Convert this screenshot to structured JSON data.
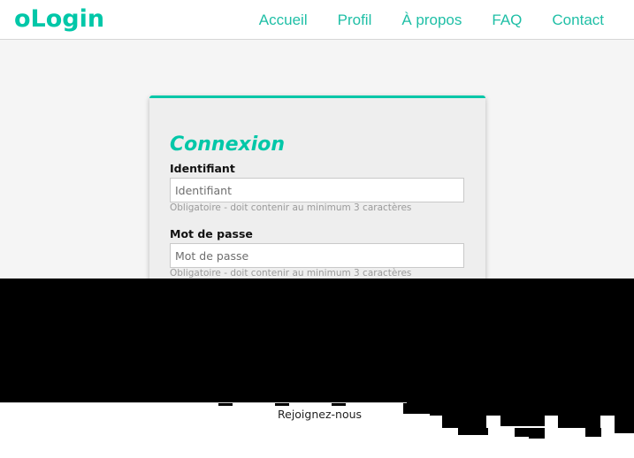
{
  "header": {
    "brand": "oLogin",
    "nav": [
      "Accueil",
      "Profil",
      "À propos",
      "FAQ",
      "Contact"
    ]
  },
  "login": {
    "title": "Connexion",
    "username": {
      "label": "Identifiant",
      "placeholder": "Identifiant",
      "help": "Obligatoire - doit contenir au minimum 3 caractères"
    },
    "password": {
      "label": "Mot de passe",
      "placeholder": "Mot de passe",
      "help": "Obligatoire - doit contenir au minimum 3 caractères"
    }
  },
  "footer": {
    "join_label": "Rejoignez-nous"
  },
  "colors": {
    "accent": "#00c7a8",
    "nav": "#1fbfa6",
    "card_bg": "#eeeeee",
    "page_bg": "#f5f5f5"
  }
}
